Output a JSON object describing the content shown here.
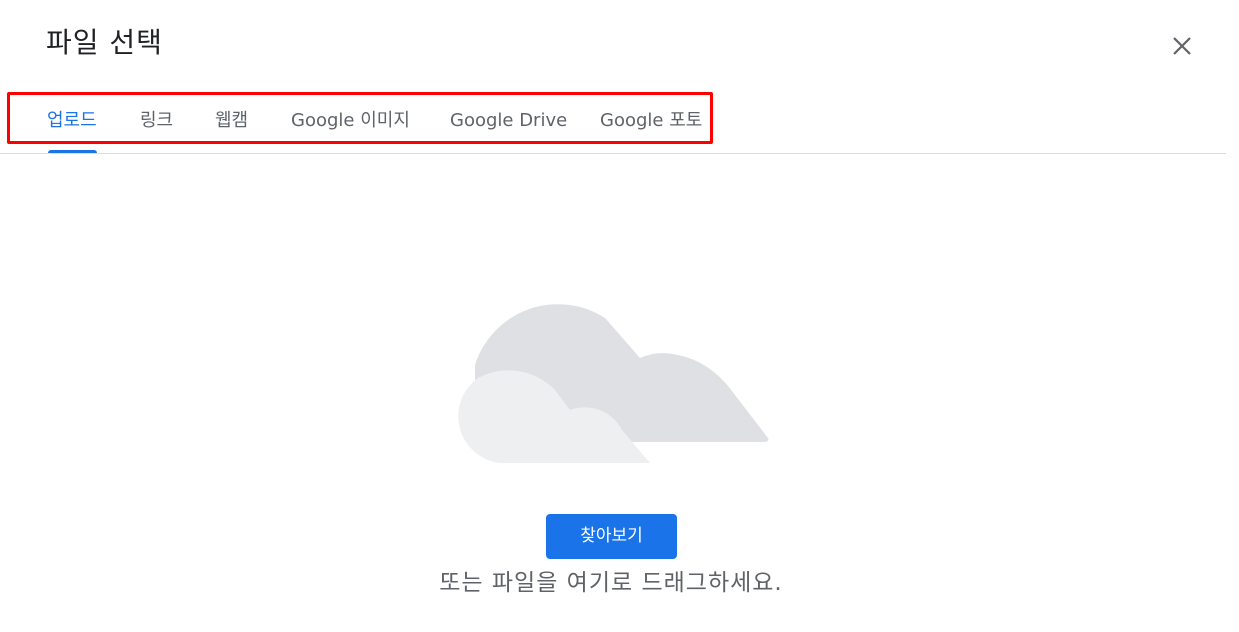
{
  "dialog": {
    "title": "파일 선택",
    "close_icon": "close-icon"
  },
  "tabs": [
    {
      "label": "업로드",
      "active": true
    },
    {
      "label": "링크",
      "active": false
    },
    {
      "label": "웹캠",
      "active": false
    },
    {
      "label": "Google 이미지",
      "active": false
    },
    {
      "label": "Google Drive",
      "active": false
    },
    {
      "label": "Google 포토",
      "active": false
    }
  ],
  "upload": {
    "illustration": "cloud-illustration",
    "browse_label": "찾아보기",
    "drop_text": "또는 파일을 여기로 드래그하세요."
  },
  "colors": {
    "accent": "#1a73e8",
    "highlight_box": "#ff0000",
    "tab_text": "#5f6368",
    "cloud_back": "#dfe0e3",
    "cloud_front": "#eeeff1"
  }
}
